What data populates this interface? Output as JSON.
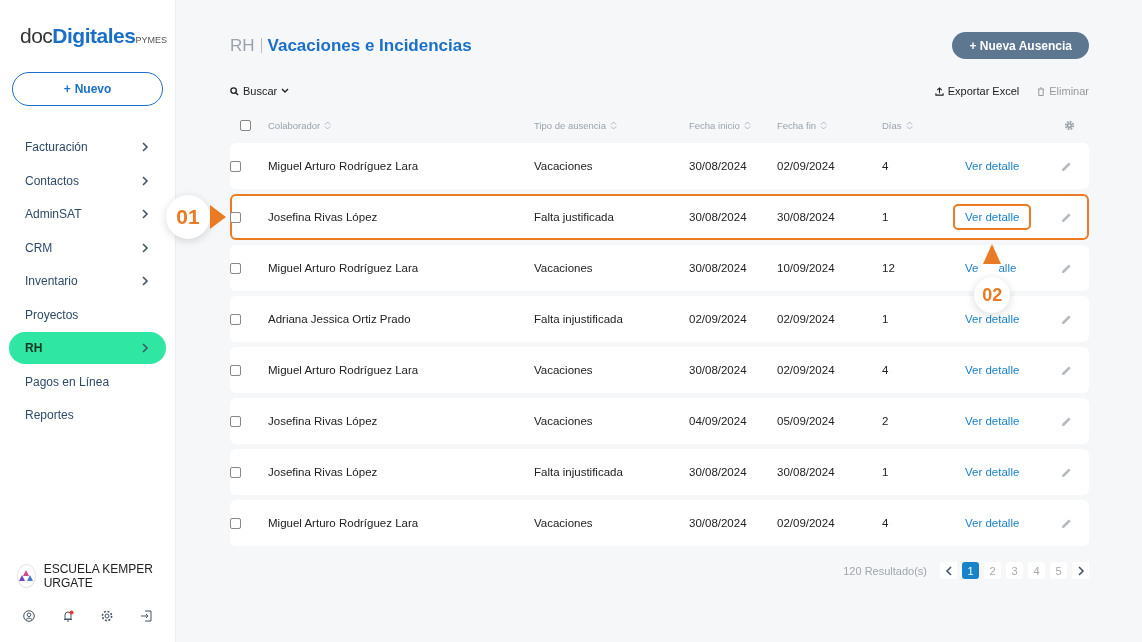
{
  "logo": {
    "prefix": "doc",
    "brand": "Digitales",
    "suffix": "PYMES"
  },
  "new_button": {
    "icon": "+",
    "label": "Nuevo"
  },
  "sidebar": {
    "items": [
      {
        "label": "Facturación",
        "has_children": true,
        "selected": false
      },
      {
        "label": "Contactos",
        "has_children": true,
        "selected": false
      },
      {
        "label": "AdminSAT",
        "has_children": true,
        "selected": false
      },
      {
        "label": "CRM",
        "has_children": true,
        "selected": false
      },
      {
        "label": "Inventario",
        "has_children": true,
        "selected": false
      },
      {
        "label": "Proyectos",
        "has_children": false,
        "selected": false
      },
      {
        "label": "RH",
        "has_children": true,
        "selected": true
      },
      {
        "label": "Pagos en Línea",
        "has_children": false,
        "selected": false
      },
      {
        "label": "Reportes",
        "has_children": false,
        "selected": false
      }
    ]
  },
  "account": {
    "name": "ESCUELA KEMPER URGATE",
    "notification": true
  },
  "breadcrumb": {
    "section": "RH",
    "title": "Vacaciones e Incidencias"
  },
  "primary_button": {
    "icon": "+",
    "label": "Nueva Ausencia"
  },
  "toolbar": {
    "search": "Buscar",
    "export": "Exportar Excel",
    "delete": {
      "label": "Eliminar",
      "disabled": true
    }
  },
  "table": {
    "select_all": {
      "checked": false
    },
    "columns": [
      "Colaborador",
      "Tipo de ausencia",
      "Fecha inicio",
      "Fecha fin",
      "Días"
    ],
    "rows": [
      {
        "name": "Miguel Arturo Rodríguez Lara",
        "type": "Vacaciones",
        "start": "30/08/2024",
        "end": "02/09/2024",
        "days": "4",
        "link": "Ver detalle",
        "checked": false,
        "highlighted": false
      },
      {
        "name": "Josefina Rivas López",
        "type": "Falta justificada",
        "start": "30/08/2024",
        "end": "30/08/2024",
        "days": "1",
        "link": "Ver detalle",
        "checked": false,
        "highlighted": true
      },
      {
        "name": "Miguel Arturo Rodríguez Lara",
        "type": "Vacaciones",
        "start": "30/08/2024",
        "end": "10/09/2024",
        "days": "12",
        "link_parts": [
          "Ve",
          "alle"
        ],
        "checked": false,
        "highlighted": false
      },
      {
        "name": "Adriana Jessica Ortiz Prado",
        "type": "Falta injustificada",
        "start": "02/09/2024",
        "end": "02/09/2024",
        "days": "1",
        "link": "Ver detalle",
        "checked": false,
        "highlighted": false
      },
      {
        "name": "Miguel Arturo Rodríguez Lara",
        "type": "Vacaciones",
        "start": "30/08/2024",
        "end": "02/09/2024",
        "days": "4",
        "link": "Ver detalle",
        "checked": false,
        "highlighted": false
      },
      {
        "name": "Josefina Rivas López",
        "type": "Vacaciones",
        "start": "04/09/2024",
        "end": "05/09/2024",
        "days": "2",
        "link": "Ver detalle",
        "checked": false,
        "highlighted": false
      },
      {
        "name": "Josefina Rivas López",
        "type": "Falta injustificada",
        "start": "30/08/2024",
        "end": "30/08/2024",
        "days": "1",
        "link": "Ver detalle",
        "checked": false,
        "highlighted": false
      },
      {
        "name": "Miguel Arturo Rodríguez Lara",
        "type": "Vacaciones",
        "start": "30/08/2024",
        "end": "02/09/2024",
        "days": "4",
        "link": "Ver detalle",
        "checked": false,
        "highlighted": false
      }
    ]
  },
  "callouts": [
    {
      "label": "01"
    },
    {
      "label": "02"
    }
  ],
  "pagination": {
    "results": "120 Resultado(s)",
    "pages": [
      {
        "label": "1",
        "selected": true
      },
      {
        "label": "2",
        "selected": false
      },
      {
        "label": "3",
        "selected": false
      },
      {
        "label": "4",
        "selected": false
      },
      {
        "label": "5",
        "selected": false
      }
    ]
  }
}
